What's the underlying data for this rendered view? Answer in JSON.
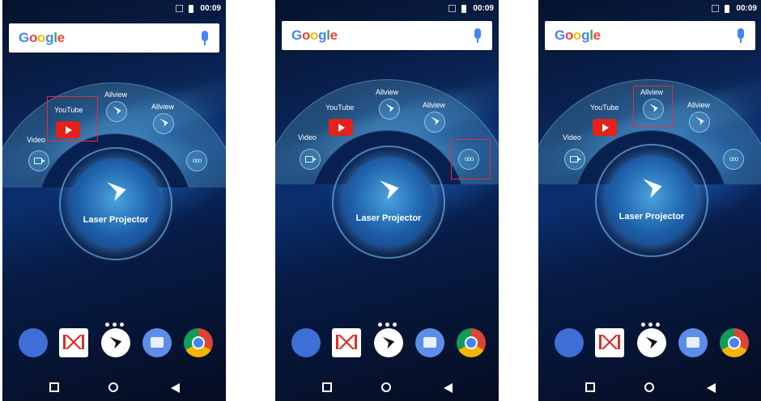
{
  "status": {
    "time": "00:09"
  },
  "search": {
    "logo_text": "Google"
  },
  "launcher": {
    "center_label": "Laser Projector",
    "apps": {
      "video": "Video",
      "youtube": "YouTube",
      "allview_1": "Allview",
      "allview_2": "Allview"
    }
  },
  "highlights": [
    "youtube",
    "more",
    "allview_1"
  ],
  "colors": {
    "highlight": "#e0303a",
    "youtube_red": "#e62117",
    "google_blue": "#4285f4"
  },
  "dock": [
    "phone-icon",
    "gmail-icon",
    "laser-projector-icon",
    "messages-icon",
    "chrome-icon"
  ],
  "nav": [
    "recent-apps-icon",
    "home-icon",
    "back-icon"
  ]
}
